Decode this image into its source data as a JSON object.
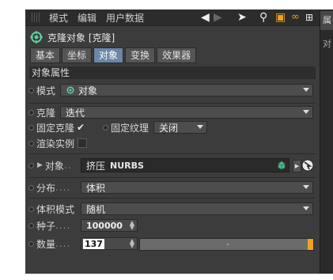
{
  "menubar": {
    "items": [
      "模式",
      "编辑",
      "用户数据"
    ]
  },
  "side_tabs": [
    "属",
    "对"
  ],
  "object": {
    "title": "克隆对象 [克隆]"
  },
  "tabs": [
    {
      "label": "基本",
      "active": false
    },
    {
      "label": "坐标",
      "active": false
    },
    {
      "label": "对象",
      "active": true
    },
    {
      "label": "变换",
      "active": false
    },
    {
      "label": "效果器",
      "active": false
    }
  ],
  "section": {
    "title": "对象属性"
  },
  "fields": {
    "mode": {
      "label": "模式",
      "value": "对象"
    },
    "clone": {
      "label": "克隆",
      "value": "迭代"
    },
    "fix_clone": {
      "label": "固定克隆",
      "checked": true
    },
    "fix_texture": {
      "label": "固定纹理",
      "value": "关闭"
    },
    "render_instance": {
      "label": "渲染实例",
      "checked": false
    },
    "object_link": {
      "label": "对象",
      "dots": "..",
      "value": "挤压",
      "value_tag": "NURBS"
    },
    "distribution": {
      "label": "分布",
      "dots": "....",
      "value": "体积"
    },
    "volume_mode": {
      "label": "体积模式",
      "value": "随机"
    },
    "seed": {
      "label": "种子",
      "dots": "....",
      "value": "100000"
    },
    "count": {
      "label": "数量",
      "dots": "....",
      "value": "137"
    }
  },
  "colors": {
    "panel": "#3c3c3c",
    "accent_tab": "#6b86a8",
    "slider_knob": "#f0a21e"
  }
}
